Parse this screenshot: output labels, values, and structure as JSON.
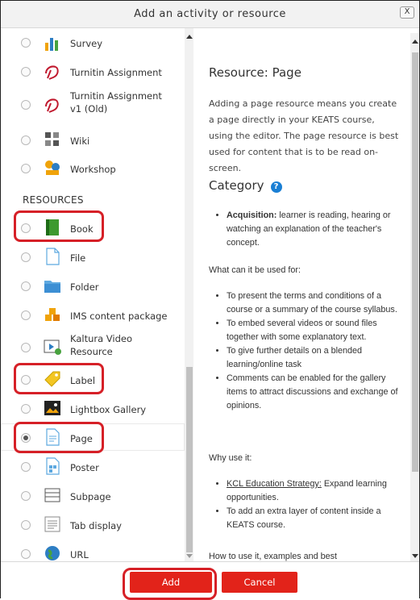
{
  "dialog": {
    "title": "Add an activity or resource",
    "close_label": "X"
  },
  "left": {
    "items_top": [
      {
        "label": "Survey",
        "icon": "survey-chart-icon"
      },
      {
        "label": "Turnitin Assignment",
        "icon": "turnitin-icon"
      },
      {
        "label": "Turnitin Assignment v1 (Old)",
        "icon": "turnitin-icon"
      },
      {
        "label": "Wiki",
        "icon": "wiki-icon"
      },
      {
        "label": "Workshop",
        "icon": "workshop-icon"
      }
    ],
    "section_label": "RESOURCES",
    "resources": [
      {
        "label": "Book"
      },
      {
        "label": "File"
      },
      {
        "label": "Folder"
      },
      {
        "label": "IMS content package"
      },
      {
        "label": "Kaltura Video Resource"
      },
      {
        "label": "Label"
      },
      {
        "label": "Lightbox Gallery"
      },
      {
        "label": "Page"
      },
      {
        "label": "Poster"
      },
      {
        "label": "Subpage"
      },
      {
        "label": "Tab display"
      },
      {
        "label": "URL"
      }
    ],
    "selected": "Page"
  },
  "right": {
    "title": "Resource: Page",
    "description": "Adding a page resource means you create a page directly in your KEATS course, using the editor. The page resource is best used for content that is to be read on-screen.",
    "category_heading": "Category",
    "category_bullet_strong": "Acquisition:",
    "category_bullet_rest": " learner is reading, hearing or watching an explanation of the teacher's concept.",
    "used_for_heading": "What can it be used for:",
    "used_for": [
      "To present the terms and conditions of a course or a summary of the course syllabus.",
      "To embed several videos or sound files together with some explanatory text.",
      "To give further details on a blended learning/online task",
      "Comments can be enabled for the gallery items to attract discussions and exchange of opinions."
    ],
    "why_heading": "Why use it:",
    "why_link": "KCL Education Strategy:",
    "why_link_rest": " Expand learning opportunities.",
    "why_2": "To add an extra layer of content inside a KEATS course.",
    "how_heading": "How to use it, examples and best"
  },
  "footer": {
    "add_label": "Add",
    "cancel_label": "Cancel"
  },
  "colors": {
    "accent": "#e2231a",
    "highlight": "#d62027",
    "help": "#1a7fd4"
  }
}
